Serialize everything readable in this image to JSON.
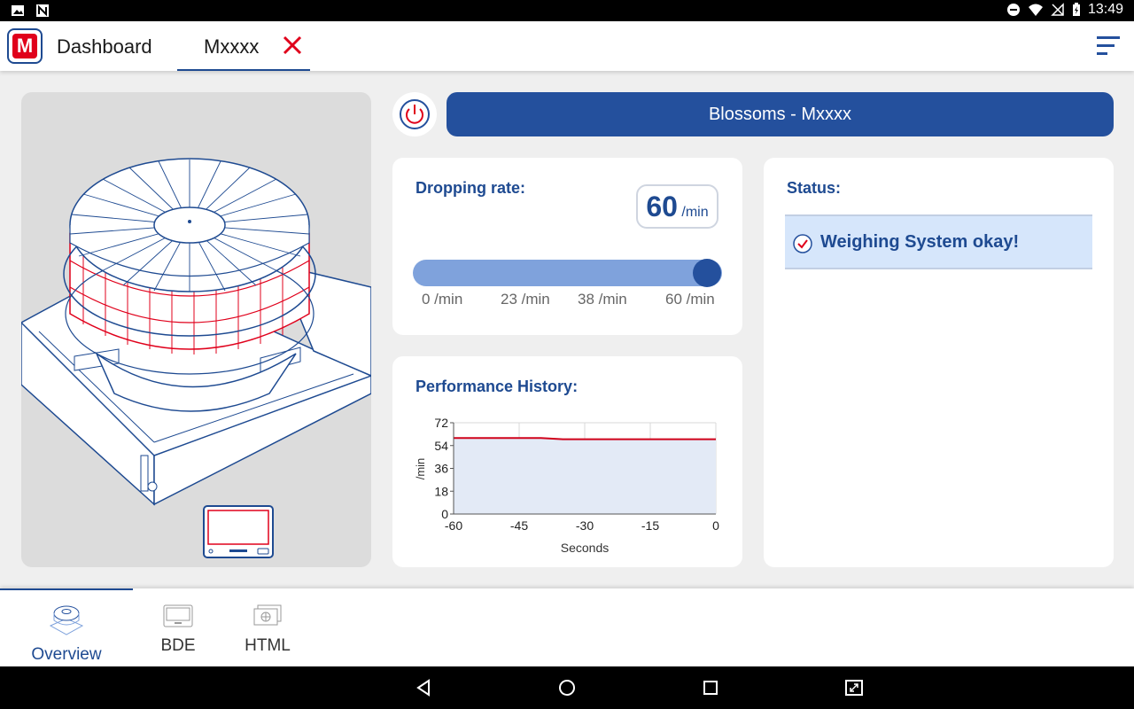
{
  "status_bar": {
    "time": "13:49"
  },
  "header": {
    "logo_text": "M",
    "tabs": [
      {
        "label": "Dashboard",
        "active": false
      },
      {
        "label": "Mxxxx",
        "active": true
      }
    ]
  },
  "machine": {
    "title": "Blossoms - Mxxxx"
  },
  "dropping_rate": {
    "title": "Dropping rate:",
    "value": "60",
    "unit": "/min",
    "slider_value": 60,
    "slider_max": 60,
    "ticks": [
      "0 /min",
      "23 /min",
      "38 /min",
      "60 /min"
    ]
  },
  "performance": {
    "title": "Performance History:",
    "chart_data": {
      "type": "area",
      "title": "",
      "xlabel": "Seconds",
      "ylabel": "/min",
      "xlim": [
        -60,
        0
      ],
      "ylim": [
        0,
        72
      ],
      "x_ticks": [
        "-60",
        "-45",
        "-30",
        "-15",
        "0"
      ],
      "y_ticks": [
        "0",
        "18",
        "36",
        "54",
        "72"
      ],
      "grid": true,
      "series": [
        {
          "x": [
            -60,
            -50,
            -40,
            -35,
            -30,
            -20,
            -10,
            0
          ],
          "y": [
            60,
            60,
            60,
            59,
            59,
            59,
            59,
            59
          ]
        }
      ],
      "line_color": "#d0021b",
      "fill_color": "#e3eaf6"
    }
  },
  "status": {
    "title": "Status:",
    "message": "Weighing System okay!"
  },
  "bottom_nav": {
    "items": [
      {
        "label": "Overview"
      },
      {
        "label": "BDE"
      },
      {
        "label": "HTML"
      }
    ]
  },
  "colors": {
    "brand_blue": "#24509d",
    "brand_red": "#e0001b",
    "slider_track": "#7fa2dc",
    "status_bg": "#d6e6fb"
  }
}
